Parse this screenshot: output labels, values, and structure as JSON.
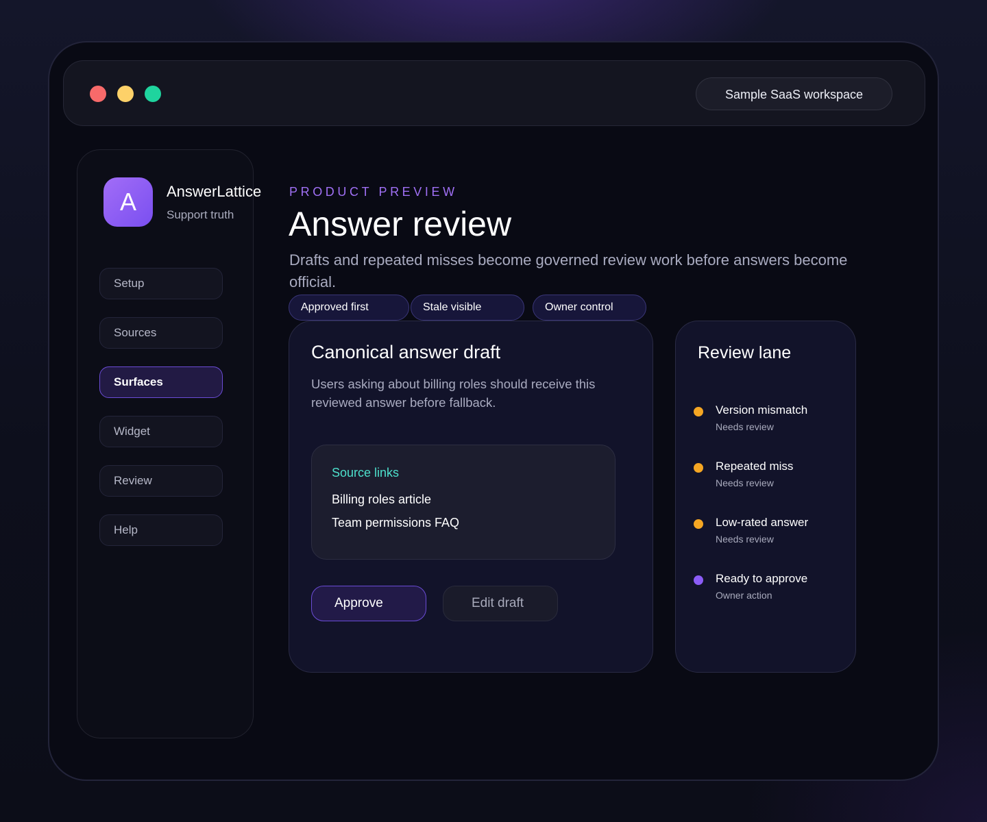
{
  "window": {
    "workspace_label": "Sample SaaS workspace",
    "traffic_lights": [
      "#f86a6a",
      "#fdd169",
      "#1fd49e"
    ]
  },
  "brand": {
    "logo_letter": "A",
    "name": "AnswerLattice",
    "tagline": "Support truth",
    "accent": "#8b5cf6"
  },
  "sidebar": {
    "items": [
      {
        "label": "Setup",
        "active": false
      },
      {
        "label": "Sources",
        "active": false
      },
      {
        "label": "Surfaces",
        "active": true
      },
      {
        "label": "Widget",
        "active": false
      },
      {
        "label": "Review",
        "active": false
      },
      {
        "label": "Help",
        "active": false
      }
    ]
  },
  "header": {
    "eyebrow": "PRODUCT PREVIEW",
    "title": "Answer review",
    "description": "Drafts and repeated misses become governed review work before answers become official."
  },
  "chips": [
    "Approved first",
    "Stale visible",
    "Owner control"
  ],
  "draft": {
    "title": "Canonical answer draft",
    "body": "Users asking about billing roles should receive this reviewed answer before fallback.",
    "sources_title": "Source links",
    "sources": [
      "Billing roles article",
      "Team permissions FAQ"
    ],
    "approve_label": "Approve",
    "edit_label": "Edit draft"
  },
  "review_lane": {
    "title": "Review lane",
    "items": [
      {
        "label": "Version mismatch",
        "status": "Needs review",
        "color": "#f5a623"
      },
      {
        "label": "Repeated miss",
        "status": "Needs review",
        "color": "#f5a623"
      },
      {
        "label": "Low-rated answer",
        "status": "Needs review",
        "color": "#f5a623"
      },
      {
        "label": "Ready to approve",
        "status": "Owner action",
        "color": "#8b5cf6"
      }
    ]
  }
}
